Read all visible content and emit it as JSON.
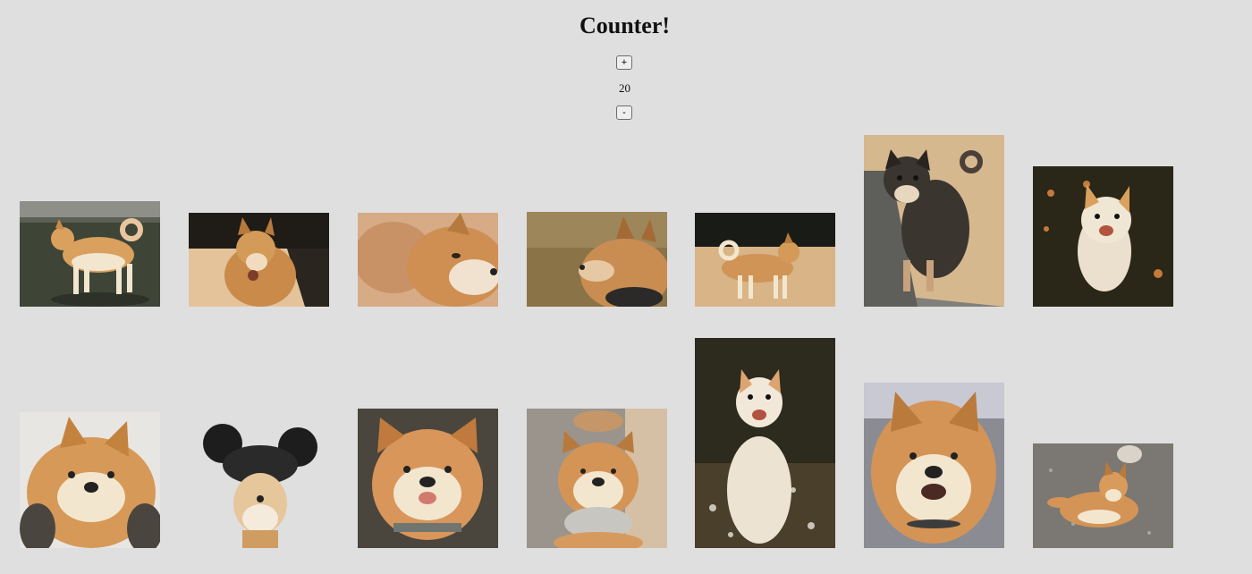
{
  "header": {
    "title": "Counter!",
    "increment_label": "+",
    "decrement_label": "-"
  },
  "counter": {
    "value": "20"
  },
  "gallery": {
    "row1": [
      "shiba-standing-field",
      "shiba-walking-sunny",
      "shiba-closeup-side",
      "shiba-profile-grass",
      "shiba-on-sand",
      "black-tan-shiba-on-ledge",
      "cream-shiba-looking-up"
    ],
    "row2": [
      "shiba-cheeks-squeezed",
      "shiba-mouse-ears-hat",
      "shiba-tongue-out",
      "shiba-bandana-smile",
      "cream-shiba-sitting-woods",
      "shiba-smiling-closeup",
      "shiba-lying-gravel"
    ]
  },
  "colors": {
    "background": "#e0dfe0",
    "shiba_orange": "#d9a05e",
    "shiba_cream": "#f3e6cf"
  }
}
